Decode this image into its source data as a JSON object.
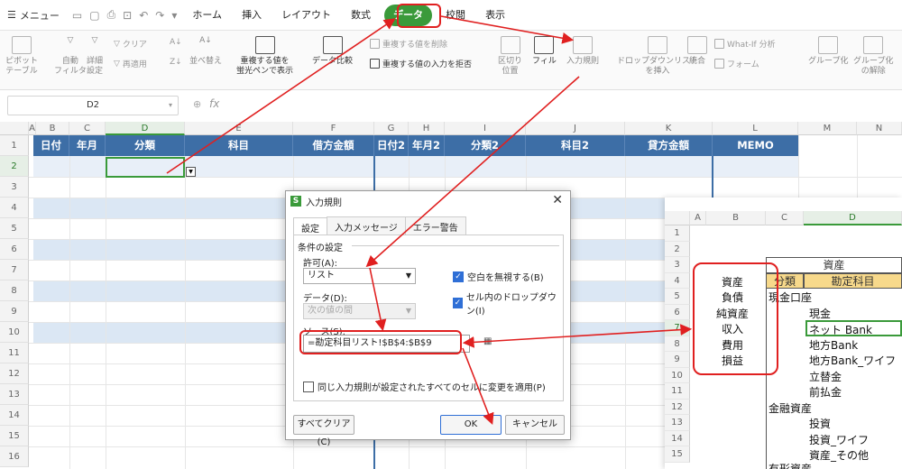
{
  "menu": {
    "label": "メニュー",
    "tabs": [
      "ホーム",
      "挿入",
      "レイアウト",
      "数式",
      "データ",
      "校閲",
      "表示"
    ]
  },
  "ribbon": {
    "pivot": "ピボット\nテーブル",
    "autofilter": "自動\nフィルタ",
    "advfilter": "詳細\n設定",
    "clear": "クリア",
    "reapply": "再適用",
    "sort": "並べ替え",
    "dup_highlight": "重複する値を\n蛍光ペンで表示",
    "dup_remove": "重複する値を削除",
    "data_compare": "データ比較",
    "dup_reject": "重複する値の入力を拒否",
    "split": "区切り\n位置",
    "fill": "フィル",
    "validation": "入力規則",
    "dropdown": "ドロップダウンリスト\nを挿入",
    "consolidate": "統合",
    "whatif": "What-If 分析",
    "form": "フォーム",
    "group": "グループ化",
    "ungroup": "グループ化\nの解除"
  },
  "formula": {
    "cell_ref": "D2",
    "fx": "fx"
  },
  "columns": [
    "A",
    "B",
    "C",
    "D",
    "E",
    "F",
    "G",
    "H",
    "I",
    "J",
    "K",
    "L",
    "M",
    "N"
  ],
  "rows": [
    "1",
    "2",
    "3",
    "4",
    "5",
    "6",
    "7",
    "8",
    "9",
    "10",
    "11",
    "12",
    "13",
    "14",
    "15",
    "16"
  ],
  "header": [
    "日付",
    "年月",
    "分類",
    "科目",
    "借方金額",
    "日付2",
    "年月2",
    "分類2",
    "科目2",
    "貸方金額",
    "MEMO"
  ],
  "dialog": {
    "title": "入力規則",
    "tabs": [
      "設定",
      "入力メッセージ",
      "エラー警告"
    ],
    "section": "条件の設定",
    "allow_label": "許可(A):",
    "allow_value": "リスト",
    "data_label": "データ(D):",
    "data_value": "次の値の間",
    "source_label": "ソース(S):",
    "source_value": "=勘定科目リスト!$B$4:$B$9",
    "ignore_blank": "空白を無視する(B)",
    "in_cell_dropdown": "セル内のドロップダウン(I)",
    "apply_all": "同じ入力規則が設定されたすべてのセルに変更を適用(P)",
    "clear_all": "すべてクリア(C)",
    "ok": "OK",
    "cancel": "キャンセル"
  },
  "side_sheet": {
    "columns": [
      "A",
      "B",
      "C",
      "D"
    ],
    "rows": [
      "1",
      "2",
      "3",
      "4",
      "5",
      "6",
      "7",
      "8",
      "9",
      "10",
      "11",
      "12",
      "13",
      "14",
      "15"
    ],
    "categories": [
      "資産",
      "負債",
      "純資産",
      "収入",
      "費用",
      "損益"
    ],
    "title": "資産",
    "col_category": "分類",
    "col_account": "勘定科目",
    "groups": [
      "現金口座",
      "金融資産"
    ],
    "accounts": [
      "現金",
      "ネット Bank",
      "地方Bank",
      "地方Bank_ワイフ",
      "立替金",
      "前払金",
      "投資",
      "投資_ワイフ",
      "資産_その他"
    ],
    "last_row_partial": "有形資産"
  },
  "colors": {
    "accent": "#3a9a3a",
    "header_blue": "#3d6ea6",
    "band": "#dbe7f4",
    "annotation": "#e02020"
  }
}
